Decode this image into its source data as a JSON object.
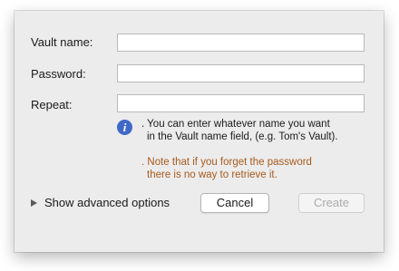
{
  "form": {
    "vault_name_label": "Vault name:",
    "vault_name_value": "",
    "password_label": "Password:",
    "password_value": "",
    "repeat_label": "Repeat:",
    "repeat_value": ""
  },
  "info": {
    "icon": "info-icon",
    "icon_glyph": "i",
    "line1": ". You can enter whatever name you want",
    "line2": "in the Vault name field, (e.g. Tom's Vault)."
  },
  "warning": {
    "line1": ". Note that if you forget the password",
    "line2": "there is no way to retrieve it.",
    "color": "#a85a1c"
  },
  "advanced": {
    "icon": "disclosure-triangle-icon",
    "label": "Show advanced options"
  },
  "buttons": {
    "cancel_label": "Cancel",
    "create_label": "Create",
    "create_enabled": false
  }
}
